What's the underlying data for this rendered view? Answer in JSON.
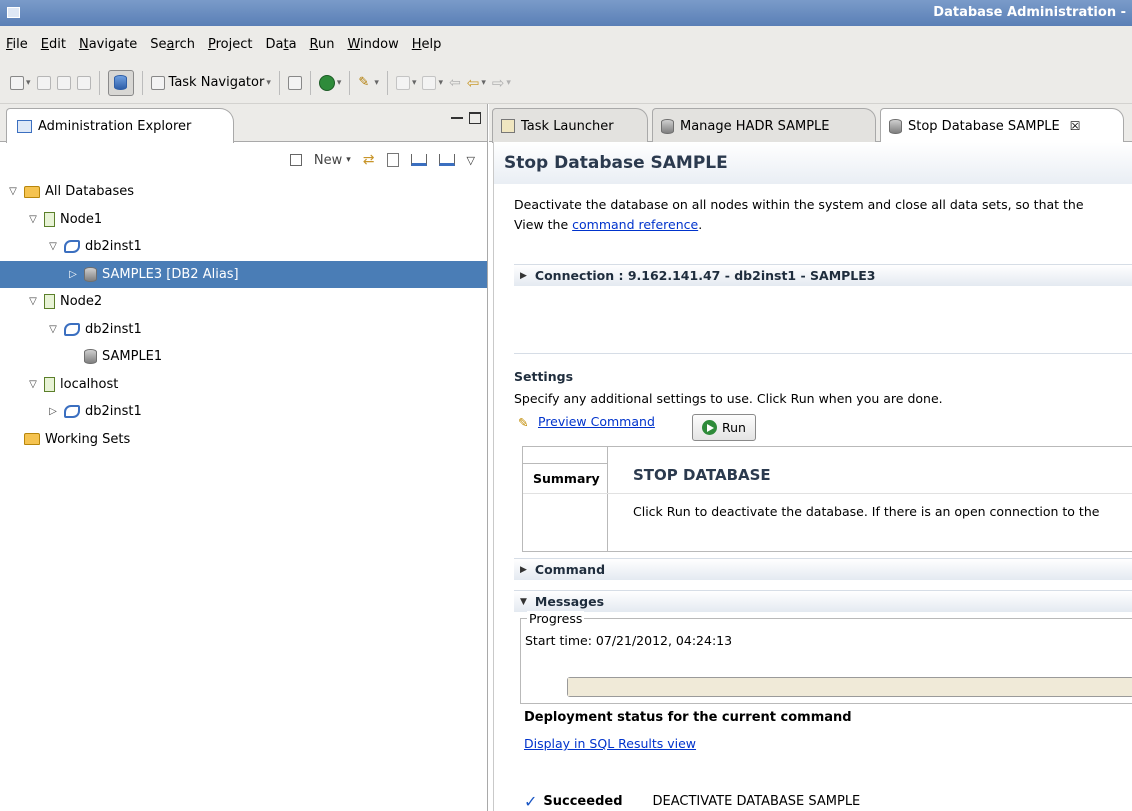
{
  "window": {
    "title": "Database Administration -"
  },
  "menu": [
    {
      "pre": "",
      "u": "F",
      "post": "ile"
    },
    {
      "pre": "",
      "u": "E",
      "post": "dit"
    },
    {
      "pre": "",
      "u": "N",
      "post": "avigate"
    },
    {
      "pre": "Se",
      "u": "a",
      "post": "rch"
    },
    {
      "pre": "",
      "u": "P",
      "post": "roject"
    },
    {
      "pre": "Da",
      "u": "t",
      "post": "a"
    },
    {
      "pre": "",
      "u": "R",
      "post": "un"
    },
    {
      "pre": "",
      "u": "W",
      "post": "indow"
    },
    {
      "pre": "",
      "u": "H",
      "post": "elp"
    }
  ],
  "toolbar": {
    "task_navigator": "Task Navigator"
  },
  "left": {
    "tab_label": "Administration Explorer",
    "new_label": "New",
    "tree": [
      {
        "level": 0,
        "twisty": "▽",
        "icon": "folder-icon",
        "label": "All Databases"
      },
      {
        "level": 1,
        "twisty": "▽",
        "icon": "node-icon",
        "label": "Node1"
      },
      {
        "level": 2,
        "twisty": "▽",
        "icon": "instance-icon",
        "label": "db2inst1"
      },
      {
        "level": 3,
        "twisty": "▷",
        "icon": "database-icon",
        "label": "SAMPLE3 [DB2 Alias]",
        "selected": true
      },
      {
        "level": 1,
        "twisty": "▽",
        "icon": "node-icon",
        "label": "Node2"
      },
      {
        "level": 2,
        "twisty": "▽",
        "icon": "instance-icon",
        "label": "db2inst1"
      },
      {
        "level": 3,
        "twisty": "",
        "icon": "database-icon",
        "label": "SAMPLE1"
      },
      {
        "level": 1,
        "twisty": "▽",
        "icon": "node-icon",
        "label": "localhost"
      },
      {
        "level": 2,
        "twisty": "▷",
        "icon": "instance-icon",
        "label": "db2inst1"
      },
      {
        "level": 0,
        "twisty": "",
        "icon": "folder-icon",
        "label": "Working Sets"
      }
    ]
  },
  "tabs": [
    {
      "label": "Task Launcher",
      "icon": "task-launcher-icon"
    },
    {
      "label": "Manage HADR SAMPLE",
      "icon": "database-icon"
    },
    {
      "label": "Stop Database SAMPLE",
      "icon": "database-icon",
      "active": true,
      "close": "☒"
    }
  ],
  "editor": {
    "title": "Stop Database SAMPLE",
    "description": "Deactivate the database on all nodes within the system and close all data sets, so that the",
    "view_prefix": "View the ",
    "view_link": "command reference",
    "view_suffix": ".",
    "connection": "Connection : 9.162.141.47 - db2inst1 - SAMPLE3",
    "settings_title": "Settings",
    "settings_desc": "Specify any additional settings to use. Click Run when you are done.",
    "preview_command": "Preview Command",
    "run_label": "Run",
    "summary_label": "Summary",
    "summary_title": "STOP DATABASE",
    "summary_text": "Click Run to deactivate the database. If there is an open connection to the",
    "command_section": "Command",
    "messages_section": "Messages",
    "progress_legend": "Progress",
    "start_time": "Start time: 07/21/2012, 04:24:13",
    "deploy_title": "Deployment status for the current command",
    "deploy_link": "Display in SQL Results view",
    "status_state": "Succeeded",
    "status_command": "DEACTIVATE DATABASE SAMPLE"
  },
  "colors": {
    "selection": "#4a7db6",
    "link": "#0033cc",
    "titlebar": "#5a7fb6",
    "success": "#1a56c4"
  }
}
